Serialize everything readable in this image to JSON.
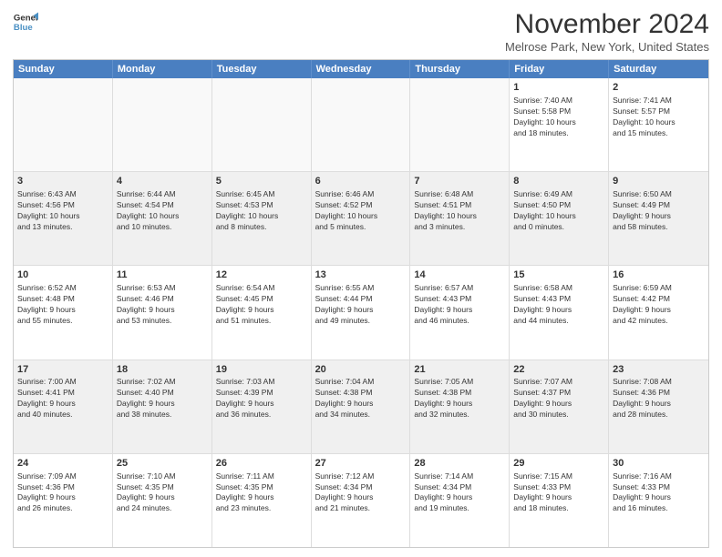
{
  "logo": {
    "line1": "General",
    "line2": "Blue"
  },
  "title": "November 2024",
  "location": "Melrose Park, New York, United States",
  "weekdays": [
    "Sunday",
    "Monday",
    "Tuesday",
    "Wednesday",
    "Thursday",
    "Friday",
    "Saturday"
  ],
  "rows": [
    [
      {
        "day": "",
        "info": ""
      },
      {
        "day": "",
        "info": ""
      },
      {
        "day": "",
        "info": ""
      },
      {
        "day": "",
        "info": ""
      },
      {
        "day": "",
        "info": ""
      },
      {
        "day": "1",
        "info": "Sunrise: 7:40 AM\nSunset: 5:58 PM\nDaylight: 10 hours\nand 18 minutes."
      },
      {
        "day": "2",
        "info": "Sunrise: 7:41 AM\nSunset: 5:57 PM\nDaylight: 10 hours\nand 15 minutes."
      }
    ],
    [
      {
        "day": "3",
        "info": "Sunrise: 6:43 AM\nSunset: 4:56 PM\nDaylight: 10 hours\nand 13 minutes."
      },
      {
        "day": "4",
        "info": "Sunrise: 6:44 AM\nSunset: 4:54 PM\nDaylight: 10 hours\nand 10 minutes."
      },
      {
        "day": "5",
        "info": "Sunrise: 6:45 AM\nSunset: 4:53 PM\nDaylight: 10 hours\nand 8 minutes."
      },
      {
        "day": "6",
        "info": "Sunrise: 6:46 AM\nSunset: 4:52 PM\nDaylight: 10 hours\nand 5 minutes."
      },
      {
        "day": "7",
        "info": "Sunrise: 6:48 AM\nSunset: 4:51 PM\nDaylight: 10 hours\nand 3 minutes."
      },
      {
        "day": "8",
        "info": "Sunrise: 6:49 AM\nSunset: 4:50 PM\nDaylight: 10 hours\nand 0 minutes."
      },
      {
        "day": "9",
        "info": "Sunrise: 6:50 AM\nSunset: 4:49 PM\nDaylight: 9 hours\nand 58 minutes."
      }
    ],
    [
      {
        "day": "10",
        "info": "Sunrise: 6:52 AM\nSunset: 4:48 PM\nDaylight: 9 hours\nand 55 minutes."
      },
      {
        "day": "11",
        "info": "Sunrise: 6:53 AM\nSunset: 4:46 PM\nDaylight: 9 hours\nand 53 minutes."
      },
      {
        "day": "12",
        "info": "Sunrise: 6:54 AM\nSunset: 4:45 PM\nDaylight: 9 hours\nand 51 minutes."
      },
      {
        "day": "13",
        "info": "Sunrise: 6:55 AM\nSunset: 4:44 PM\nDaylight: 9 hours\nand 49 minutes."
      },
      {
        "day": "14",
        "info": "Sunrise: 6:57 AM\nSunset: 4:43 PM\nDaylight: 9 hours\nand 46 minutes."
      },
      {
        "day": "15",
        "info": "Sunrise: 6:58 AM\nSunset: 4:43 PM\nDaylight: 9 hours\nand 44 minutes."
      },
      {
        "day": "16",
        "info": "Sunrise: 6:59 AM\nSunset: 4:42 PM\nDaylight: 9 hours\nand 42 minutes."
      }
    ],
    [
      {
        "day": "17",
        "info": "Sunrise: 7:00 AM\nSunset: 4:41 PM\nDaylight: 9 hours\nand 40 minutes."
      },
      {
        "day": "18",
        "info": "Sunrise: 7:02 AM\nSunset: 4:40 PM\nDaylight: 9 hours\nand 38 minutes."
      },
      {
        "day": "19",
        "info": "Sunrise: 7:03 AM\nSunset: 4:39 PM\nDaylight: 9 hours\nand 36 minutes."
      },
      {
        "day": "20",
        "info": "Sunrise: 7:04 AM\nSunset: 4:38 PM\nDaylight: 9 hours\nand 34 minutes."
      },
      {
        "day": "21",
        "info": "Sunrise: 7:05 AM\nSunset: 4:38 PM\nDaylight: 9 hours\nand 32 minutes."
      },
      {
        "day": "22",
        "info": "Sunrise: 7:07 AM\nSunset: 4:37 PM\nDaylight: 9 hours\nand 30 minutes."
      },
      {
        "day": "23",
        "info": "Sunrise: 7:08 AM\nSunset: 4:36 PM\nDaylight: 9 hours\nand 28 minutes."
      }
    ],
    [
      {
        "day": "24",
        "info": "Sunrise: 7:09 AM\nSunset: 4:36 PM\nDaylight: 9 hours\nand 26 minutes."
      },
      {
        "day": "25",
        "info": "Sunrise: 7:10 AM\nSunset: 4:35 PM\nDaylight: 9 hours\nand 24 minutes."
      },
      {
        "day": "26",
        "info": "Sunrise: 7:11 AM\nSunset: 4:35 PM\nDaylight: 9 hours\nand 23 minutes."
      },
      {
        "day": "27",
        "info": "Sunrise: 7:12 AM\nSunset: 4:34 PM\nDaylight: 9 hours\nand 21 minutes."
      },
      {
        "day": "28",
        "info": "Sunrise: 7:14 AM\nSunset: 4:34 PM\nDaylight: 9 hours\nand 19 minutes."
      },
      {
        "day": "29",
        "info": "Sunrise: 7:15 AM\nSunset: 4:33 PM\nDaylight: 9 hours\nand 18 minutes."
      },
      {
        "day": "30",
        "info": "Sunrise: 7:16 AM\nSunset: 4:33 PM\nDaylight: 9 hours\nand 16 minutes."
      }
    ]
  ]
}
